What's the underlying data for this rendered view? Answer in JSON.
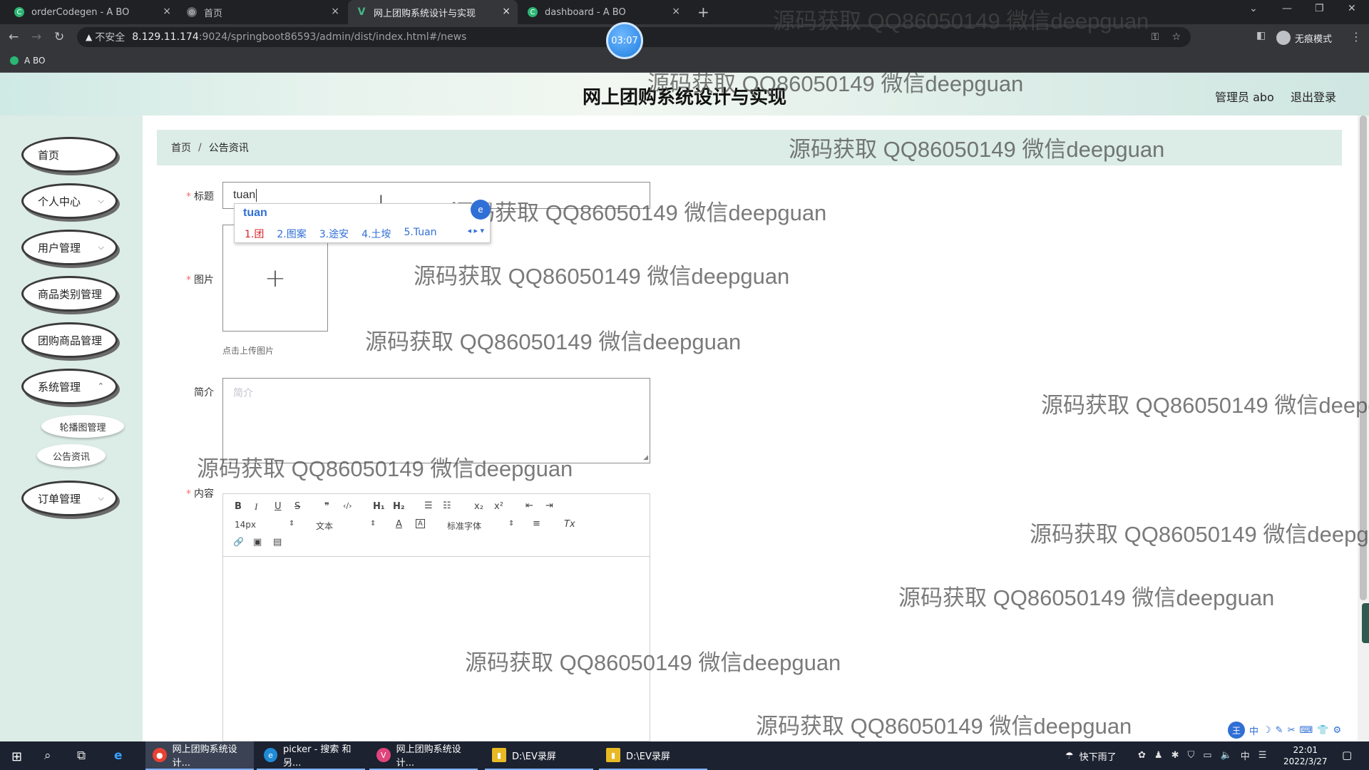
{
  "browser": {
    "tabs": [
      {
        "title": "orderCodegen - A BO",
        "fav": "C",
        "favcolor": "#2bb673"
      },
      {
        "title": "首页",
        "fav": "◎",
        "favcolor": "#5f6368"
      },
      {
        "title": "网上团购系统设计与实现",
        "fav": "V",
        "favcolor": "#41b883"
      },
      {
        "title": "dashboard - A BO",
        "fav": "C",
        "favcolor": "#2bb673"
      }
    ],
    "tab_close": "×",
    "new_tab": "+",
    "address": {
      "insecure_label": "不安全",
      "host": "8.129.11.174",
      "path": ":9024/springboot86593/admin/dist/index.html#/news"
    },
    "profile_label": "无痕模式",
    "bookmark": "A BO",
    "recording_timer": "03:07"
  },
  "header": {
    "title": "网上团购系统设计与实现",
    "user_label": "管理员 abo",
    "logout_label": "退出登录"
  },
  "sidebar": {
    "items": [
      {
        "label": "首页",
        "has_children": false
      },
      {
        "label": "个人中心",
        "has_children": true
      },
      {
        "label": "用户管理",
        "has_children": true
      },
      {
        "label": "商品类别管理",
        "has_children": false
      },
      {
        "label": "团购商品管理",
        "has_children": false
      },
      {
        "label": "系统管理",
        "has_children": true
      },
      {
        "label": "订单管理",
        "has_children": true
      }
    ],
    "subitems": [
      {
        "label": "轮播图管理"
      },
      {
        "label": "公告资讯"
      }
    ]
  },
  "breadcrumb": {
    "home": "首页",
    "separator": "/",
    "current": "公告资讯"
  },
  "form": {
    "title_label": "标题",
    "title_value": "tuan",
    "image_label": "图片",
    "upload_plus": "+",
    "upload_tip": "点击上传图片",
    "intro_label": "简介",
    "intro_placeholder": "简介",
    "content_label": "内容",
    "required_mark": "*"
  },
  "editor_toolbar": {
    "bold": "B",
    "italic": "I",
    "underline": "U",
    "strike": "S",
    "quote": "❞",
    "code": "‹/›",
    "h1": "H₁",
    "h2": "H₂",
    "ordered_list": "☰",
    "bullet_list": "☷",
    "subscript": "x₂",
    "superscript": "x²",
    "outdent": "⇤",
    "indent": "⇥",
    "size_select": "14px",
    "text_select": "文本",
    "font_color": "A",
    "background_color": "A",
    "font_select": "标准字体",
    "align": "≡",
    "clean": "Tx",
    "link": "🔗",
    "image": "▣",
    "video": "▤",
    "select_arrow": "⇕"
  },
  "ime": {
    "composition": "tuan",
    "candidates": [
      "1.团",
      "2.图案",
      "3.途安",
      "4.土垵",
      "5.Tuan"
    ],
    "pager": "◂ ▸ ▾",
    "logo": "e",
    "tray_badge": "王",
    "tray_items": [
      "中",
      "☽",
      "✎",
      "✂",
      "⌨",
      "👕",
      "⚙"
    ]
  },
  "watermark_text": "源码获取 QQ86050149 微信deepguan",
  "taskbar": {
    "apps": [
      {
        "label": "网上团购系统设计...",
        "icon": "●",
        "color": "#e94235"
      },
      {
        "label": "picker - 搜索 和另...",
        "icon": "e",
        "color": "#1f8bd6"
      },
      {
        "label": "网上团购系统设计...",
        "icon": "V",
        "color": "#e0457b"
      },
      {
        "label": "D:\\EV录屏",
        "icon": "▮",
        "color": "#e8b923"
      },
      {
        "label": "D:\\EV录屏",
        "icon": "▮",
        "color": "#e8b923"
      }
    ],
    "weather": "快下雨了",
    "ime_indicator": "中",
    "time": "22:01",
    "date": "2022/3/27"
  }
}
